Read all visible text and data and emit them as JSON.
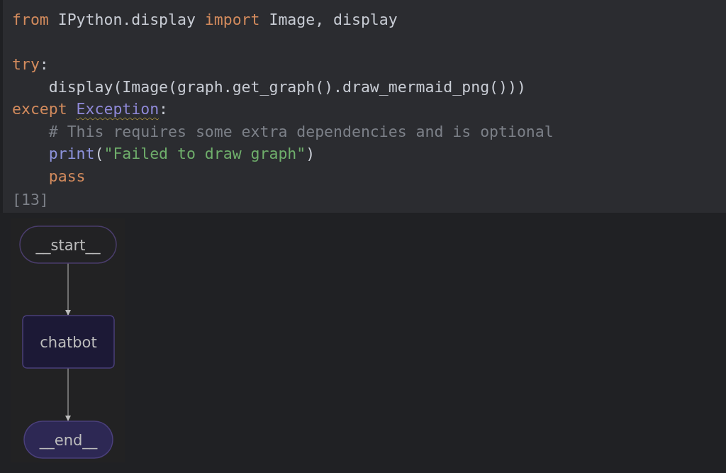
{
  "code_cell": {
    "lines": [
      {
        "kind": "code",
        "tokens": [
          {
            "text": "from",
            "kind": "keyword"
          },
          {
            "text": " IPython.display ",
            "kind": "plain"
          },
          {
            "text": "import",
            "kind": "keyword"
          },
          {
            "text": " Image, display",
            "kind": "plain"
          }
        ]
      },
      {
        "kind": "blank"
      },
      {
        "kind": "code",
        "tokens": [
          {
            "text": "try",
            "kind": "keyword"
          },
          {
            "text": ":",
            "kind": "plain"
          }
        ]
      },
      {
        "kind": "code",
        "tokens": [
          {
            "text": "    display(Image(graph.get_graph().draw_mermaid_png()))",
            "kind": "plain"
          }
        ]
      },
      {
        "kind": "code",
        "tokens": [
          {
            "text": "except ",
            "kind": "keyword"
          },
          {
            "text": "Exception",
            "kind": "class",
            "warning": true
          },
          {
            "text": ":",
            "kind": "plain"
          }
        ]
      },
      {
        "kind": "code",
        "tokens": [
          {
            "text": "    # This requires some extra dependencies and is optional",
            "kind": "comment"
          }
        ]
      },
      {
        "kind": "code",
        "tokens": [
          {
            "text": "    print",
            "kind": "builtin"
          },
          {
            "text": "(",
            "kind": "plain"
          },
          {
            "text": "\"Failed to draw graph\"",
            "kind": "string"
          },
          {
            "text": ")",
            "kind": "plain"
          }
        ]
      },
      {
        "kind": "code",
        "tokens": [
          {
            "text": "    pass",
            "kind": "keyword"
          }
        ]
      }
    ],
    "execution_count": "[13]"
  },
  "output": {
    "graph": {
      "nodes": [
        {
          "label": "__start__",
          "kind": "start"
        },
        {
          "label": "chatbot",
          "kind": "step"
        },
        {
          "label": "__end__",
          "kind": "end"
        }
      ]
    }
  }
}
